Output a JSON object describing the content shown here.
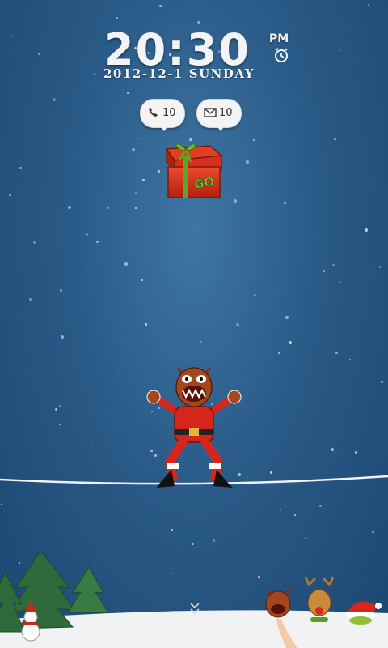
{
  "lockscreen": {
    "time": "20:30",
    "ampm": "PM",
    "date": "2012-12-1 SUNDAY",
    "alarm_icon": "alarm-clock-icon"
  },
  "notifications": {
    "missed_calls": {
      "icon": "phone-icon",
      "count": "10"
    },
    "messages": {
      "icon": "envelope-icon",
      "count": "10"
    }
  },
  "gift": {
    "icon": "gift-box-icon",
    "label": "GO"
  },
  "unlock": {
    "hint_icon": "double-chevron-down-icon"
  },
  "colors": {
    "sky_top": "#3e76a3",
    "sky_bottom": "#1d4672",
    "gift_red": "#d8301f",
    "ribbon_green": "#5aa62a"
  }
}
